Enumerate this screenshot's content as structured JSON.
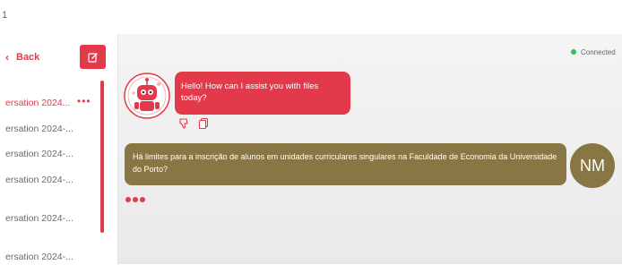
{
  "topbar": {
    "text": "1"
  },
  "sidebar": {
    "back_label": "Back",
    "new_chat_icon": "edit-icon",
    "conversations": [
      {
        "label": "ersation 2024...",
        "active": true
      },
      {
        "label": "ersation 2024-..."
      },
      {
        "label": "ersation 2024-..."
      },
      {
        "label": "ersation 2024-..."
      },
      {
        "label": "ersation 2024-..."
      },
      {
        "label": "ersation 2024-..."
      }
    ],
    "more_label": "•••"
  },
  "status": {
    "label": "Connected",
    "color": "#2ebd59"
  },
  "messages": {
    "bot": {
      "text": "Hello! How can I assist you with files today?"
    },
    "user": {
      "text": "Há limites para a inscrição de alunos em unidades curriculares singulares na Faculdade de Economia da Universidade do Porto?",
      "initials": "NM"
    }
  },
  "colors": {
    "accent": "#e23a4b",
    "user_bubble": "#887745"
  }
}
